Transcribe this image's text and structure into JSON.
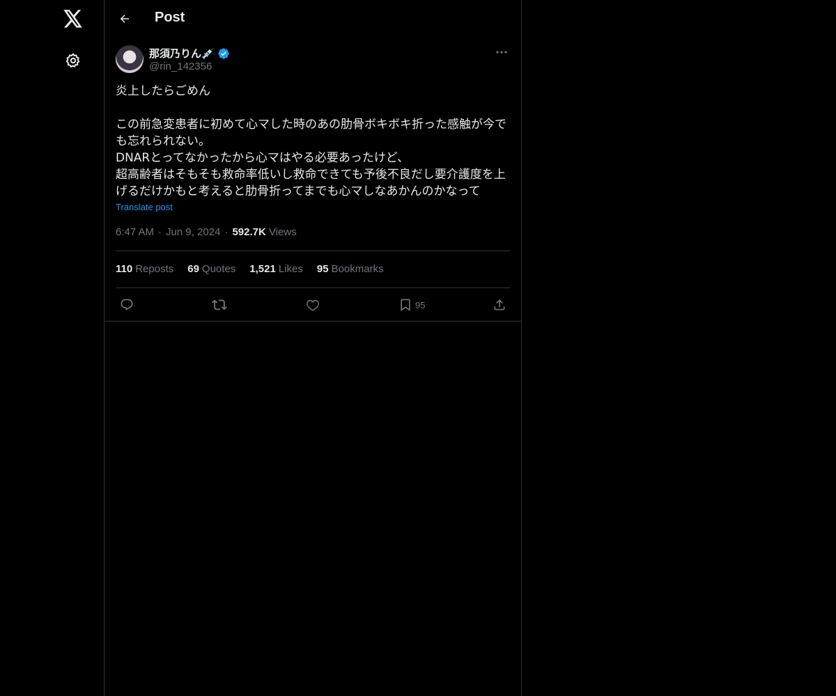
{
  "nav": {
    "logo_icon": "x-logo-icon",
    "settings_icon": "gear-icon"
  },
  "header": {
    "title": "Post"
  },
  "post": {
    "author": {
      "display_name": "那須乃りん💉",
      "handle": "@rin_142356",
      "verified": true
    },
    "text": "炎上したらごめん\n\nこの前急変患者に初めて心マした時のあの肋骨ボキボキ折った感触が今でも忘れられない。\nDNARとってなかったから心マはやる必要あったけど、\n超高齢者はそもそも救命率低いし救命できても予後不良だし要介護度を上げるだけかもと考えると肋骨折ってまでも心マしなあかんのかなって",
    "translate_label": "Translate post",
    "time": "6:47 AM",
    "date": "Jun 9, 2024",
    "views_count": "592.7K",
    "views_label": "Views",
    "separator": "·"
  },
  "stats": [
    {
      "count": "110",
      "label": "Reposts"
    },
    {
      "count": "69",
      "label": "Quotes"
    },
    {
      "count": "1,521",
      "label": "Likes"
    },
    {
      "count": "95",
      "label": "Bookmarks"
    }
  ],
  "actions": {
    "bookmark_count": "95"
  },
  "colors": {
    "background": "#000000",
    "text": "#e7e9ea",
    "muted": "#71767b",
    "accent": "#1d9bf0",
    "border": "#2f3336"
  }
}
